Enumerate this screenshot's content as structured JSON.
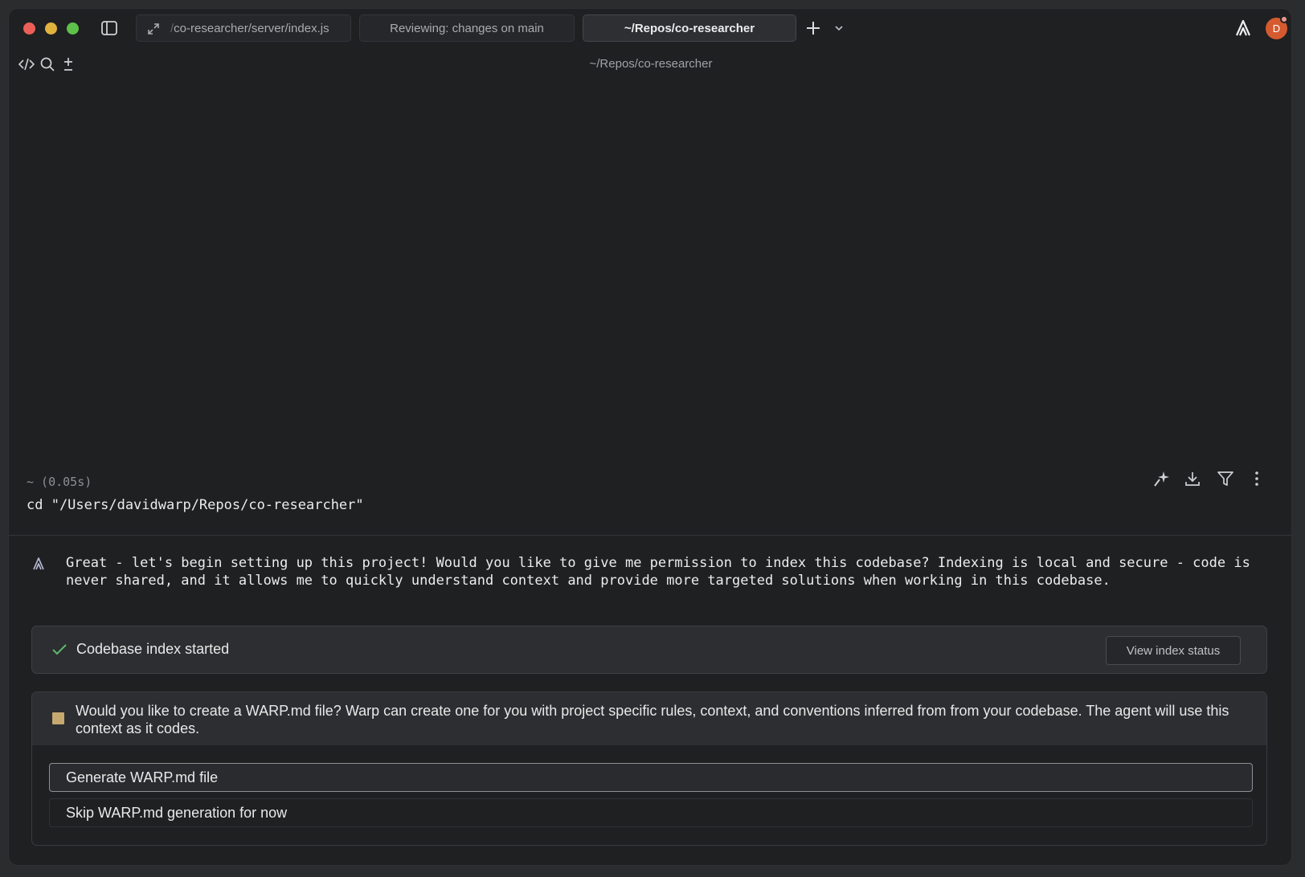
{
  "tabs": [
    {
      "prefix": "/",
      "label": "co-researcher/server/index.js"
    },
    {
      "label": "Reviewing: changes on main"
    },
    {
      "label": "~/Repos/co-researcher"
    }
  ],
  "avatar": {
    "initial": "D",
    "color": "#d65a2f"
  },
  "header": {
    "path": "~/Repos/co-researcher"
  },
  "block": {
    "meta": "~  (0.05s)",
    "command": "cd \"/Users/davidwarp/Repos/co-researcher\""
  },
  "agent": {
    "message": "Great - let's begin setting up this project! Would you like to give me permission to index this codebase? Indexing is local and secure - code is never shared, and it allows me to quickly understand context and provide more targeted solutions when working in this codebase."
  },
  "index_card": {
    "status": "Codebase index started",
    "button": "View index status"
  },
  "warp_md": {
    "question": "Would you like to create a WARP.md file? Warp can create one for you with project specific rules, context, and conventions inferred from from your codebase. The agent will use this context as it codes.",
    "options": [
      "Generate WARP.md file",
      "Skip WARP.md generation for now"
    ]
  },
  "colors": {
    "background": "#1f2022",
    "accent_check": "#5fb86a",
    "pending_square": "#c5a96f"
  },
  "icons": [
    "sidebar-toggle-icon",
    "expand-icon",
    "plus-icon",
    "chevron-down-icon",
    "warp-logo-icon",
    "code-icon",
    "search-icon",
    "plus-minus-icon",
    "sparkle-icon",
    "download-icon",
    "filter-icon",
    "more-vertical-icon",
    "agent-icon",
    "check-icon"
  ]
}
